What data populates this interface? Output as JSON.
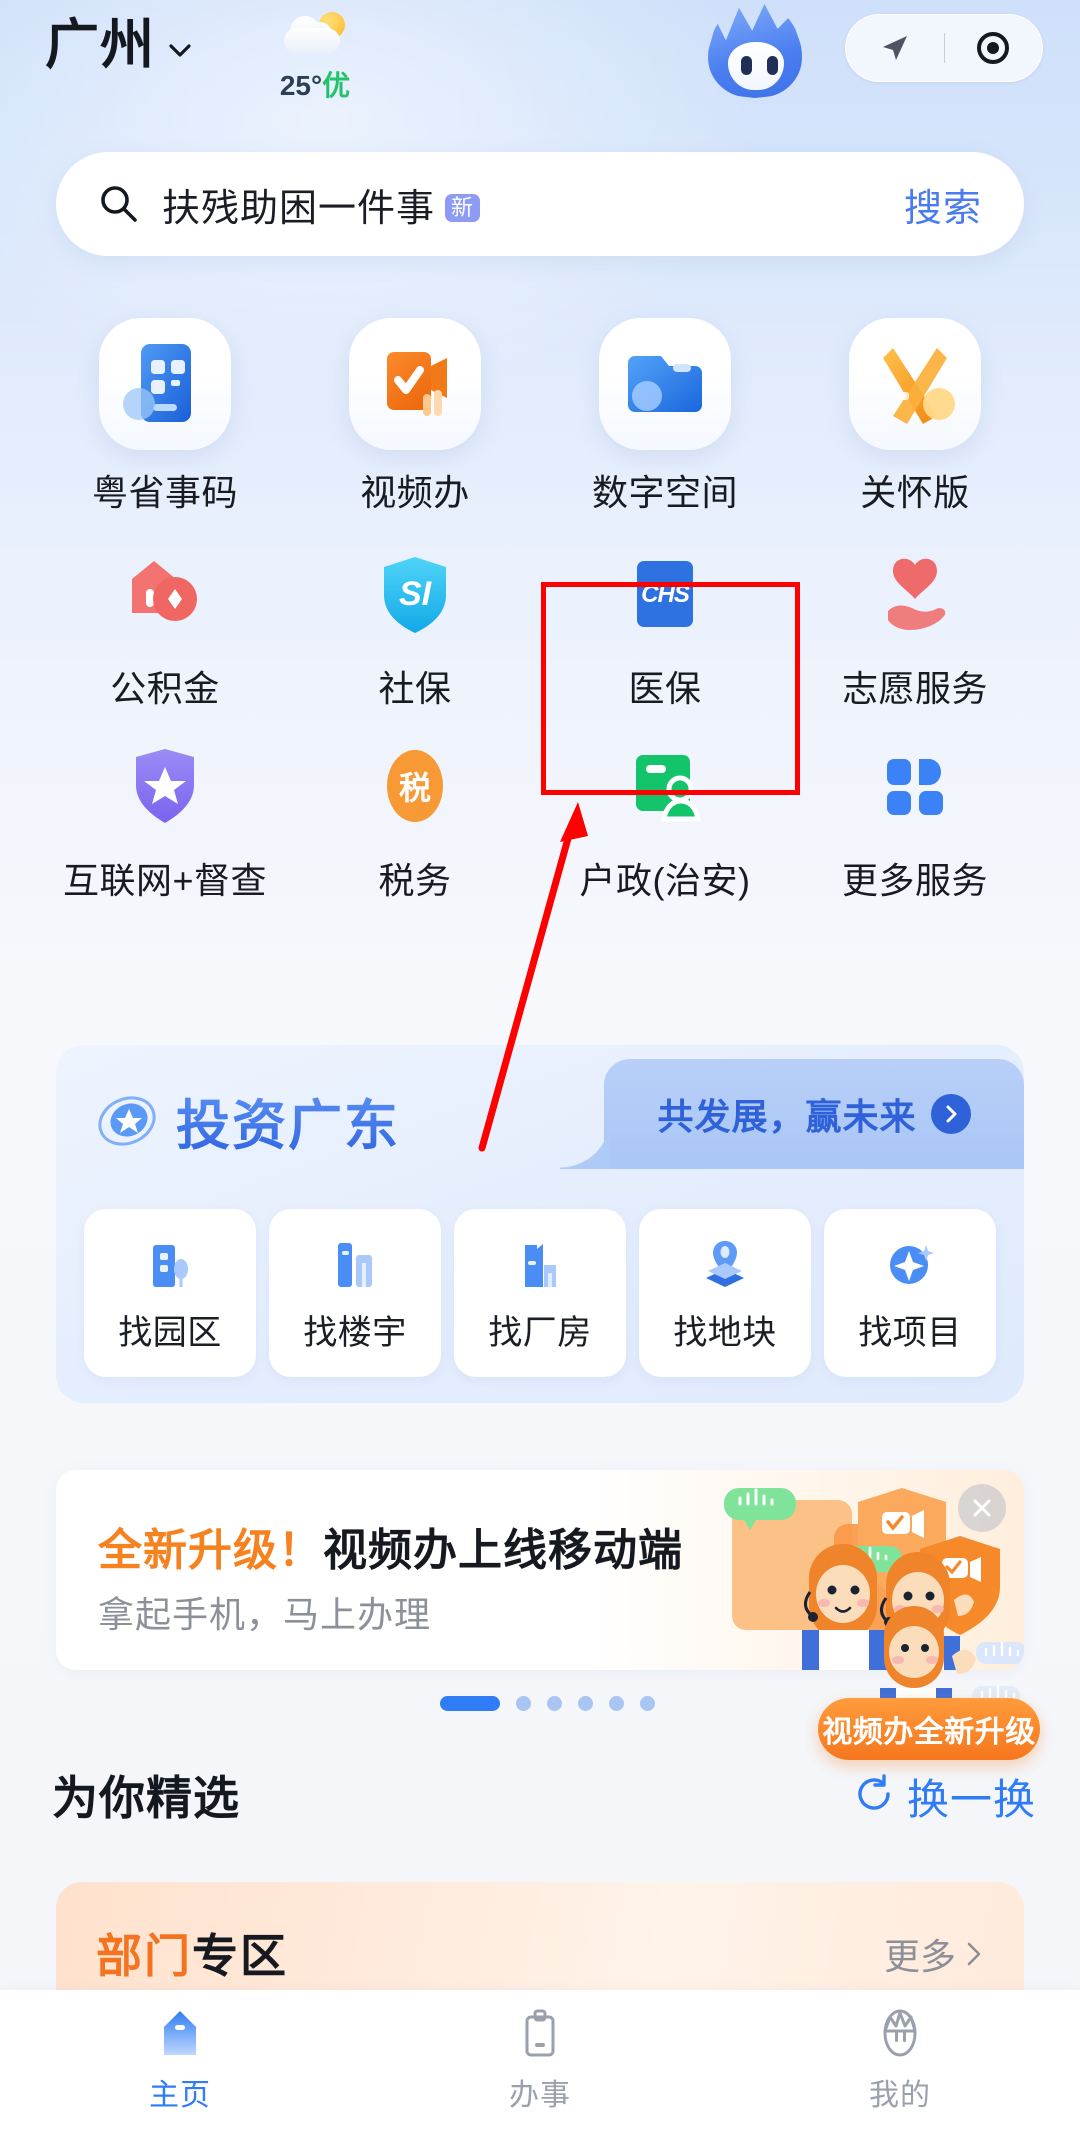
{
  "header": {
    "city": "广州",
    "city_chevron_icon": "chevron-down-icon",
    "weather": {
      "icon": "partly-cloudy-icon",
      "temperature": "25°",
      "air_quality": "优"
    },
    "mascot_icon": "mascot-avatar-icon",
    "capsule": {
      "navigate_icon": "navigate-arrow-icon",
      "record_icon": "record-target-icon"
    }
  },
  "search": {
    "icon": "search-icon",
    "query": "扶残助困一件事",
    "badge": "新",
    "button_label": "搜索"
  },
  "grid": {
    "rows": [
      {
        "style": "large",
        "items": [
          {
            "label": "粤省事码",
            "icon": "qr-code-card-icon"
          },
          {
            "label": "视频办",
            "icon": "video-service-icon"
          },
          {
            "label": "数字空间",
            "icon": "digital-folder-icon"
          },
          {
            "label": "关怀版",
            "icon": "care-ribbon-icon"
          }
        ]
      },
      {
        "style": "small",
        "items": [
          {
            "label": "公积金",
            "icon": "house-fund-icon"
          },
          {
            "label": "社保",
            "icon": "social-insurance-shield-icon"
          },
          {
            "label": "医保",
            "icon": "chs-medical-insurance-icon",
            "highlighted": true
          },
          {
            "label": "志愿服务",
            "icon": "heart-hand-icon"
          }
        ]
      },
      {
        "style": "small",
        "items": [
          {
            "label": "互联网+督查",
            "icon": "star-shield-icon"
          },
          {
            "label": "税务",
            "icon": "tax-coin-icon"
          },
          {
            "label": "户政(治安)",
            "icon": "id-card-person-icon"
          },
          {
            "label": "更多服务",
            "icon": "grid-more-icon"
          }
        ]
      }
    ]
  },
  "annotation": {
    "box_color": "#fe0000",
    "arrow_color": "#fe0000",
    "target_label": "医保"
  },
  "invest": {
    "logo_icon": "invest-swirl-logo-icon",
    "title": "投资广东",
    "tab_label": "共发展，赢未来",
    "tab_chevron_icon": "chevron-right-circle-icon",
    "items": [
      {
        "label": "找园区",
        "icon": "park-building-icon"
      },
      {
        "label": "找楼宇",
        "icon": "office-tower-icon"
      },
      {
        "label": "找厂房",
        "icon": "factory-icon"
      },
      {
        "label": "找地块",
        "icon": "land-pin-icon"
      },
      {
        "label": "找项目",
        "icon": "project-spark-icon"
      }
    ]
  },
  "promo": {
    "title_highlight": "全新升级！",
    "title_rest": "视频办上线移动端",
    "subtitle": "拿起手机，马上办理",
    "close_icon": "close-icon",
    "art_icon": "video-agent-illustration",
    "dots": {
      "total": 6,
      "active_index": 0
    },
    "float_badge": "视频办全新升级"
  },
  "section": {
    "title": "为你精选",
    "refresh_icon": "refresh-icon",
    "refresh_label": "换一换"
  },
  "dept": {
    "title_orange": "部门",
    "title_black": "专区",
    "more_label": "更多",
    "more_chevron_icon": "chevron-right-icon"
  },
  "tabbar": {
    "items": [
      {
        "label": "主页",
        "icon": "home-icon",
        "active": true
      },
      {
        "label": "办事",
        "icon": "clipboard-icon",
        "active": false
      },
      {
        "label": "我的",
        "icon": "profile-mascot-icon",
        "active": false
      }
    ]
  },
  "colors": {
    "accent_blue": "#2f7cf6",
    "annotation_red": "#fe0000",
    "promo_orange": "#f6821f",
    "aqi_green": "#22c36a"
  }
}
